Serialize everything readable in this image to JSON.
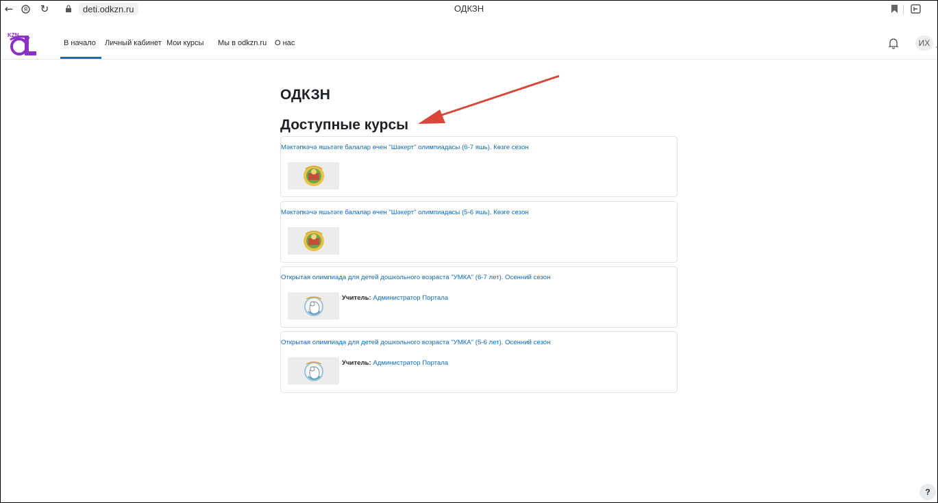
{
  "browser": {
    "back_icon": "arrow-left-icon",
    "reload_icon": "reload-icon",
    "url": "deti.odkzn.ru",
    "tab_title": "ОДКЗН"
  },
  "navbar": {
    "logo_text": "KZN",
    "items": [
      "В начало",
      "Личный кабинет",
      "Мои курсы",
      "Мы в odkzn.ru",
      "О нас"
    ],
    "active_index": 0,
    "user_initials": "ИХ"
  },
  "main": {
    "site_title": "ОДКЗН",
    "section_title": "Доступные курсы",
    "courses": [
      {
        "title": "Мәктәпкәчә яшьтәге балалар өчен \"Шәкерт\" олимпиадасы (6-7 яшь). Көзге сезон"
      },
      {
        "title": "Мәктәпкәчә яшьтәге балалар өчен \"Шәкерт\" олимпиадасы (5-6 яшь). Көзге сезон"
      },
      {
        "title": "Открытая олимпиада для детей дошкольного возраста \"УМКА\" (6-7 лет). Осенний сезон",
        "teacher_label": "Учитель:",
        "teacher_name": "Администратор Портала"
      },
      {
        "title": "Открытая олимпиада для детей дошкольного возраста \"УМКА\" (5-6 лет). Осенний сезон",
        "teacher_label": "Учитель:",
        "teacher_name": "Администратор Портала"
      }
    ]
  },
  "help_label": "?",
  "colors": {
    "link": "#0f6cbf",
    "accent": "#0f6cbf",
    "arrow": "#d9473b",
    "logo": "#8b2fc9"
  }
}
